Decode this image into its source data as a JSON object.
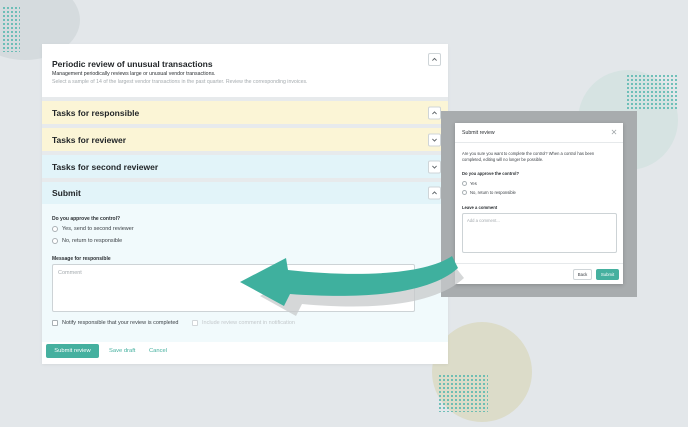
{
  "intro": {
    "title": "Periodic review of unusual transactions",
    "description": "Management periodically reviews large or unusual vendor transactions.",
    "instruction": "Select a sample of 14 of the largest vendor transactions in the past quarter. Review the corresponding invoices."
  },
  "sections": {
    "responsible": "Tasks for responsible",
    "reviewer": "Tasks for reviewer",
    "second_reviewer": "Tasks for second reviewer",
    "submit": "Submit"
  },
  "submit_form": {
    "question": "Do you approve the control?",
    "options": [
      "Yes, send to second reviewer",
      "No, return to responsible"
    ],
    "message_label": "Message for responsible",
    "message_placeholder": "Comment",
    "notify_label": "Notify responsible that your review is completed",
    "include_label": "Include review comment in notification"
  },
  "footer": {
    "submit_label": "Submit review",
    "save_draft_label": "Save draft",
    "cancel_label": "Cancel"
  },
  "dialog": {
    "title": "Submit review",
    "body": "Are you sure you want to complete the control? When a control has been completed, editing will no longer be possible.",
    "question": "Do you approve the control?",
    "options": [
      "Yes",
      "No, return to responsible"
    ],
    "comment_label": "Leave a comment",
    "comment_placeholder": "Add a comment...",
    "back_label": "Back",
    "submit_label": "Submit"
  },
  "colors": {
    "accent": "#45b09f",
    "responsible_band": "#fbf5d6",
    "reviewer_band": "#e2f4f9",
    "background": "#e3e7ea"
  },
  "icons": [
    "chevron-up-icon",
    "chevron-down-icon",
    "close-icon",
    "arrow-graphic"
  ]
}
